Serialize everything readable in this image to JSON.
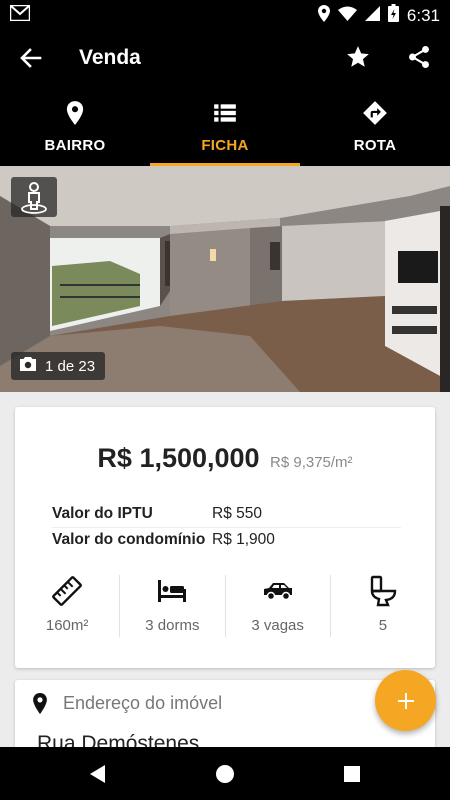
{
  "status_bar": {
    "time": "6:31",
    "icons": [
      "gmail-icon",
      "location-icon",
      "wifi-icon",
      "signal-icon",
      "battery-icon"
    ]
  },
  "app_bar": {
    "title": "Venda",
    "icons": [
      "back-arrow-icon",
      "star-icon",
      "share-icon"
    ]
  },
  "tabs": [
    {
      "label": "BAIRRO",
      "icon": "location-pin-icon",
      "active": false
    },
    {
      "label": "FICHA",
      "icon": "list-icon",
      "active": true
    },
    {
      "label": "ROTA",
      "icon": "directions-icon",
      "active": false
    }
  ],
  "colors": {
    "accent": "#f5a623",
    "toolbar": "#000000",
    "background": "#ececec"
  },
  "photo": {
    "counter": "1 de 23",
    "icons": [
      "tour-360-icon",
      "camera-icon"
    ]
  },
  "listing": {
    "price": "R$ 1,500,000",
    "price_per_m2": "R$ 9,375/m²",
    "fees": [
      {
        "label": "Valor do IPTU",
        "value": "R$ 550"
      },
      {
        "label": "Valor do condomínio",
        "value": "R$ 1,900"
      }
    ],
    "features": [
      {
        "icon": "ruler-icon",
        "value": "160m²"
      },
      {
        "icon": "bed-icon",
        "value": "3 dorms"
      },
      {
        "icon": "car-icon",
        "value": "3 vagas"
      },
      {
        "icon": "toilet-icon",
        "value": "5"
      }
    ]
  },
  "address": {
    "label": "Endereço do imóvel",
    "street": "Rua Demóstenes"
  },
  "fab": {
    "icon": "plus-icon"
  },
  "nav_bar": {
    "icons": [
      "back-triangle-icon",
      "home-circle-icon",
      "recents-square-icon"
    ]
  }
}
